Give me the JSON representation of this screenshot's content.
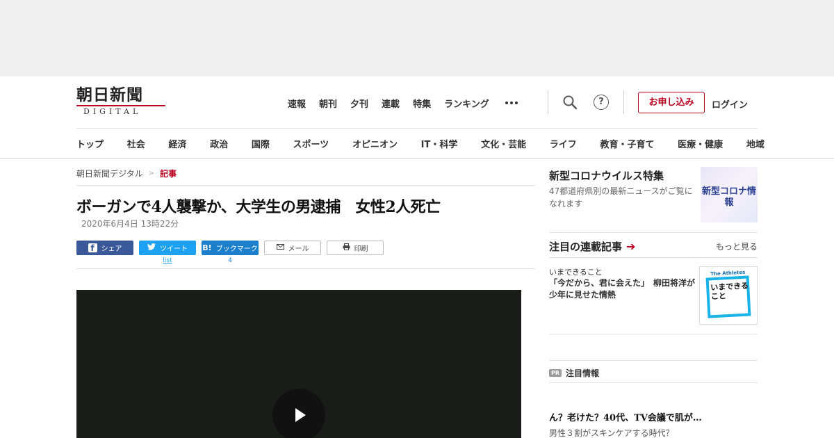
{
  "header": {
    "logo_main": "朝日新聞",
    "logo_sub": "DIGITAL",
    "top_nav": [
      "速報",
      "朝刊",
      "夕刊",
      "連載",
      "特集",
      "ランキング"
    ],
    "help_glyph": "?",
    "subscribe_label": "お申し込み",
    "login_label": "ログイン",
    "categories": [
      "トップ",
      "社会",
      "経済",
      "政治",
      "国際",
      "スポーツ",
      "オピニオン",
      "IT・科学",
      "文化・芸能",
      "ライフ",
      "教育・子育て",
      "医療・健康",
      "地域"
    ]
  },
  "breadcrumb": {
    "home": "朝日新聞デジタル",
    "separator": ">",
    "current": "記事"
  },
  "article": {
    "title": "ボーガンで4人襲撃か、大学生の男逮捕　女性2人死亡",
    "date": "2020年6月4日 13時22分"
  },
  "share": {
    "facebook_label": "シェア",
    "twitter_label": "ツイート",
    "twitter_count": "list",
    "hatena_glyph": "B!",
    "hatena_label": "ブックマーク",
    "hatena_count": "4",
    "mail_label": "メール",
    "print_label": "印刷"
  },
  "sidebar": {
    "corona_title": "新型コロナウイルス特集",
    "corona_desc": "47都道府県別の最新ニュースがご覧になれます",
    "corona_thumb_text": "新型コロナ情報",
    "series_title": "注目の連載記事",
    "more_label": "もっと見る",
    "series_kicker": "いまできること",
    "series_text": "「今だから、君に会えた」　柳田将洋が少年に見せた情熱",
    "series_thumb_top": "The Athletes",
    "series_thumb_text": "いまできること",
    "pr_badge": "PR",
    "pr_label": "注目情報",
    "pr_title": "ん？老けた？40代、TV会議で肌が…",
    "pr_sub": "男性３割がスキンケアする時代？"
  },
  "colors": {
    "brand_red": "#b8001f",
    "facebook": "#3b5998",
    "twitter": "#1da1f2",
    "hatena": "#1b7fcc"
  }
}
